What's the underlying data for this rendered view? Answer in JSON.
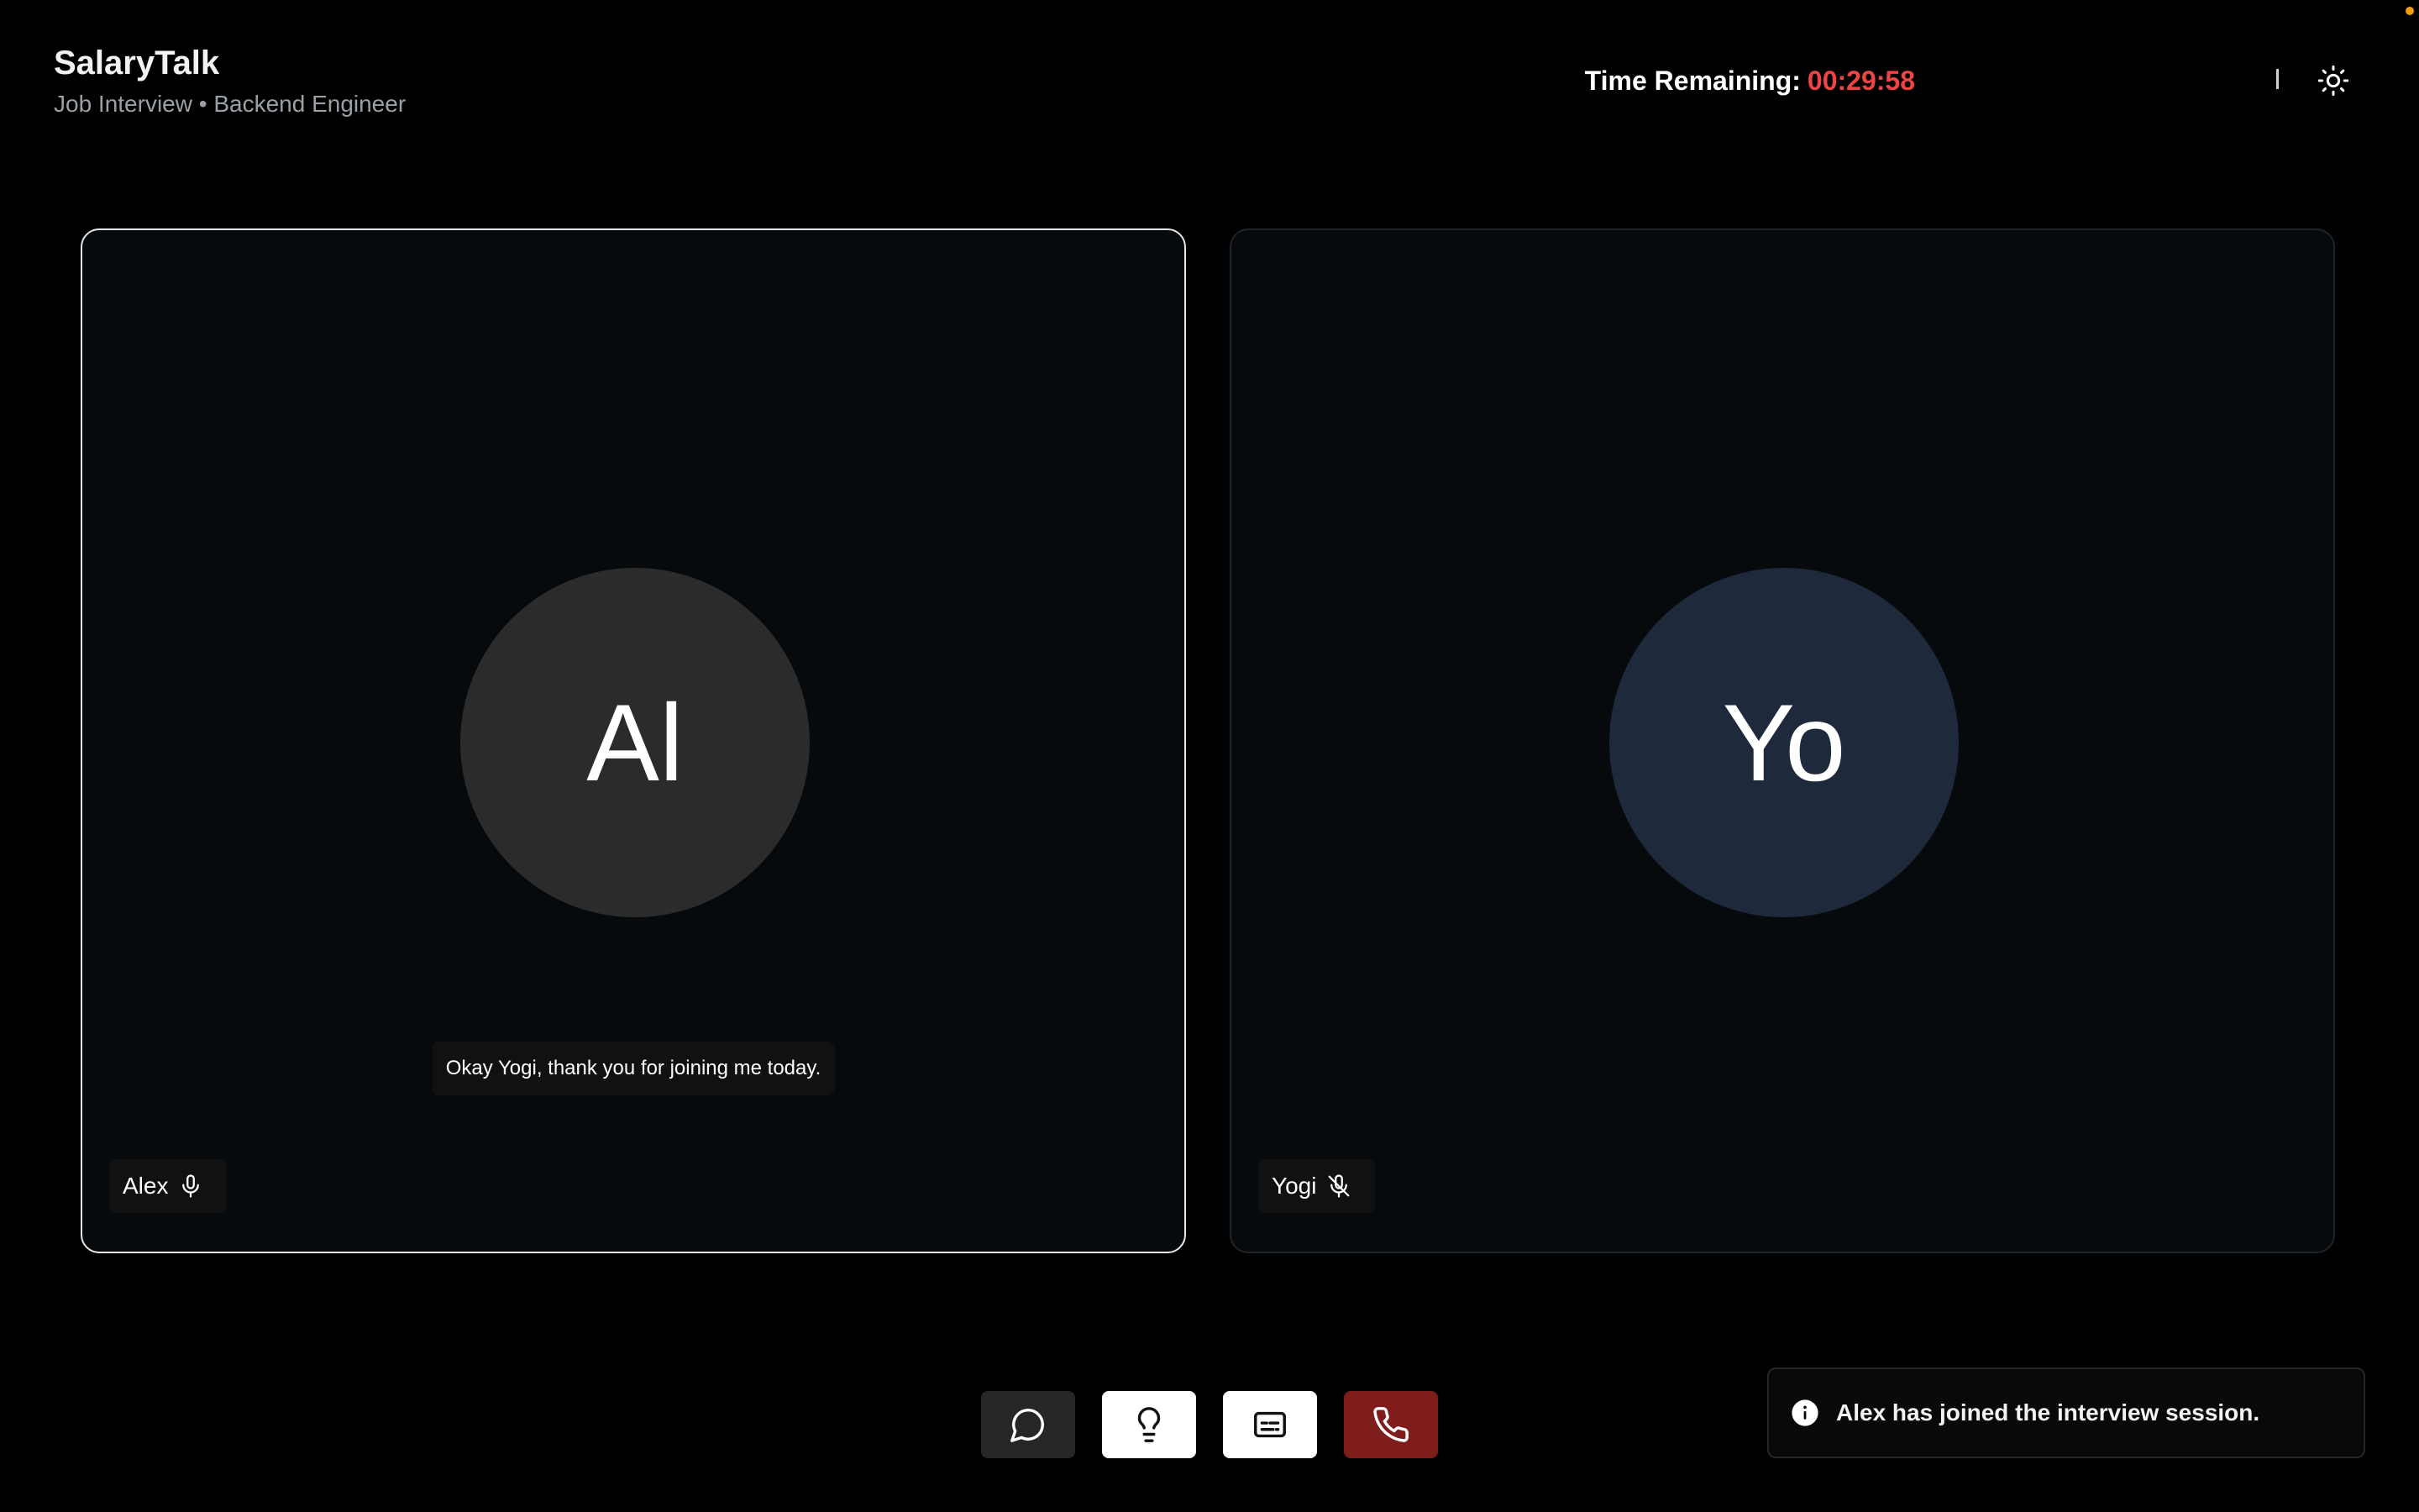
{
  "header": {
    "app_title": "SalaryTalk",
    "subtitle": "Job Interview • Backend Engineer",
    "timer_label": "Time Remaining:",
    "timer_value": "00:29:58",
    "theme_icon": "sun-icon"
  },
  "participants": [
    {
      "name": "Alex",
      "initials": "Al",
      "mic_state": "on",
      "mic_icon": "microphone-icon",
      "caption": "Okay Yogi, thank you for joining me today.",
      "avatar_color": "#2b2b2b"
    },
    {
      "name": "Yogi",
      "initials": "Yo",
      "mic_state": "muted",
      "mic_icon": "microphone-off-icon",
      "avatar_color": "#1e293b"
    }
  ],
  "controls": [
    {
      "name": "chat",
      "icon": "chat-bubble-icon"
    },
    {
      "name": "hints",
      "icon": "lightbulb-icon"
    },
    {
      "name": "captions",
      "icon": "closed-captions-icon"
    },
    {
      "name": "end-call",
      "icon": "phone-icon",
      "color": "#7f1d1d"
    }
  ],
  "toast": {
    "icon": "info-icon",
    "message": "Alex has joined the interview session."
  },
  "colors": {
    "timer_value": "#ef4444",
    "end_call": "#7f1d1d",
    "status_dot": "#f59e0b"
  }
}
